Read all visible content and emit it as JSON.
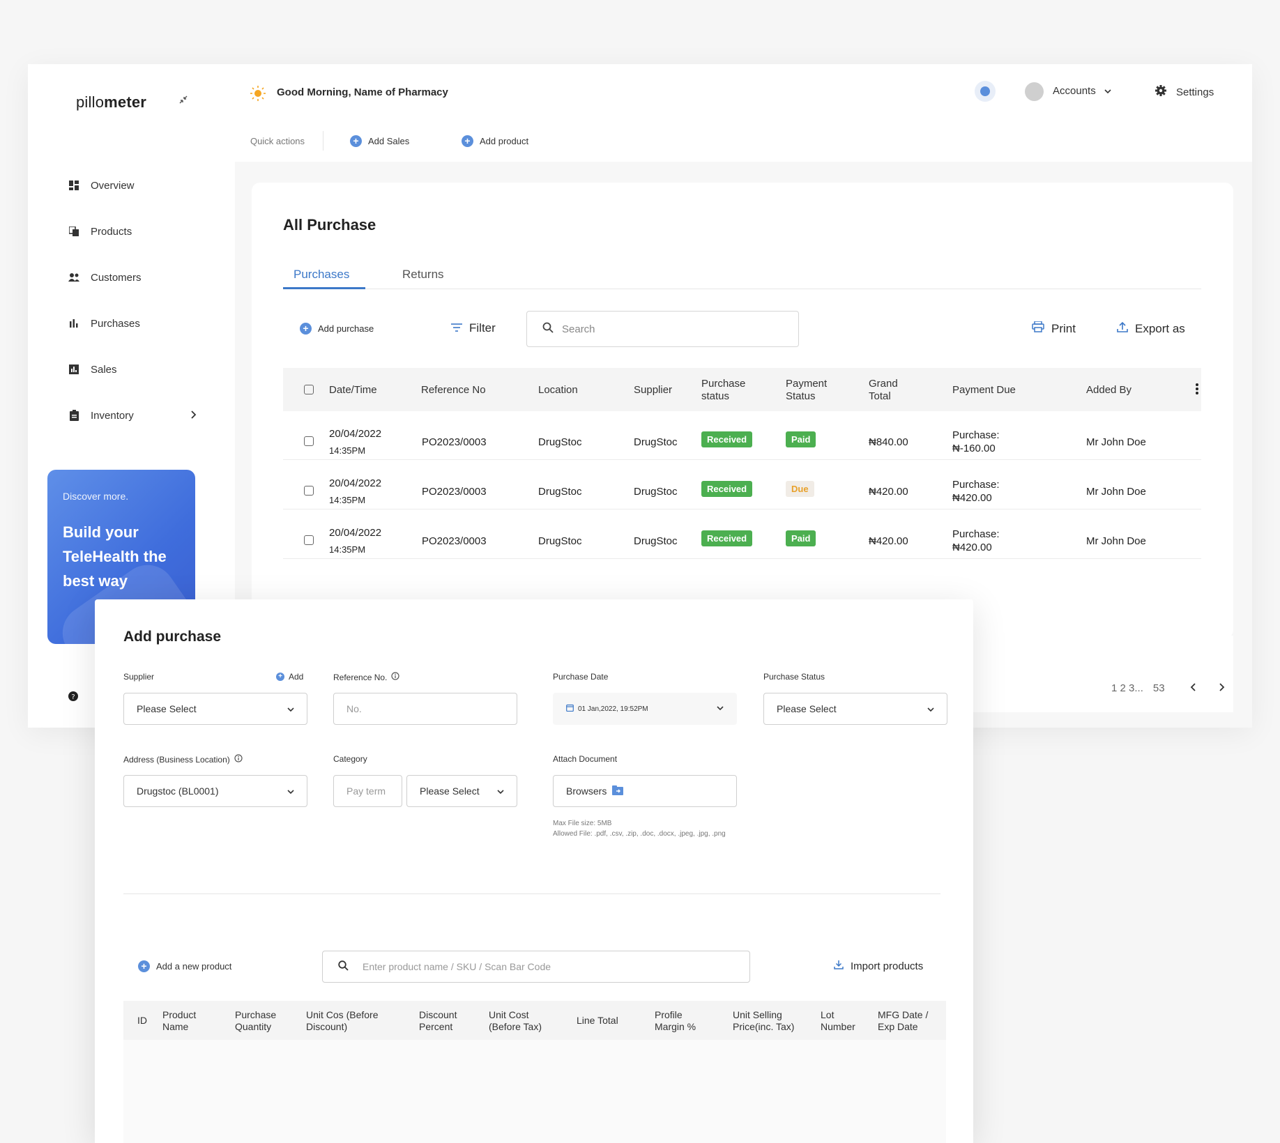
{
  "brand": {
    "prefix": "pillo",
    "suffix": "meter"
  },
  "header": {
    "greeting": "Good Morning, Name of Pharmacy",
    "accounts_label": "Accounts",
    "settings_label": "Settings"
  },
  "quick_actions": {
    "label": "Quick actions",
    "add_sales": "Add Sales",
    "add_product": "Add product"
  },
  "sidebar": {
    "items": [
      {
        "label": "Overview",
        "icon": "grid-icon"
      },
      {
        "label": "Products",
        "icon": "copy-icon"
      },
      {
        "label": "Customers",
        "icon": "users-icon"
      },
      {
        "label": "Purchases",
        "icon": "bar-chart-icon"
      },
      {
        "label": "Sales",
        "icon": "chart-box-icon"
      },
      {
        "label": "Inventory",
        "icon": "clipboard-icon"
      }
    ],
    "promo": {
      "small": "Discover more.",
      "big": "Build your TeleHealth the best way"
    }
  },
  "page": {
    "title": "All Purchase",
    "tabs": [
      "Purchases",
      "Returns"
    ],
    "toolbar": {
      "add_purchase": "Add purchase",
      "filter": "Filter",
      "search_placeholder": "Search",
      "print": "Print",
      "export": "Export as"
    },
    "table": {
      "headers": [
        "Date/Time",
        "Reference No",
        "Location",
        "Supplier",
        "Purchase status",
        "Payment Status",
        "Grand Total",
        "Payment Due",
        "Added By"
      ],
      "rows": [
        {
          "date": "20/04/2022",
          "time": "14:35PM",
          "ref": "PO2023/0003",
          "location": "DrugStoc",
          "supplier": "DrugStoc",
          "pstatus": "Received",
          "paystatus": "Paid",
          "total": "₦840.00",
          "due_label": "Purchase:",
          "due_value": "₦-160.00",
          "added_by": "Mr John Doe"
        },
        {
          "date": "20/04/2022",
          "time": "14:35PM",
          "ref": "PO2023/0003",
          "location": "DrugStoc",
          "supplier": "DrugStoc",
          "pstatus": "Received",
          "paystatus": "Due",
          "total": "₦420.00",
          "due_label": "Purchase:",
          "due_value": "₦420.00",
          "added_by": "Mr John Doe"
        },
        {
          "date": "20/04/2022",
          "time": "14:35PM",
          "ref": "PO2023/0003",
          "location": "DrugStoc",
          "supplier": "DrugStoc",
          "pstatus": "Received",
          "paystatus": "Paid",
          "total": "₦420.00",
          "due_label": "Purchase:",
          "due_value": "₦420.00",
          "added_by": "Mr John Doe"
        }
      ]
    },
    "pagination": {
      "pages": "1 2 3...",
      "last": "53"
    }
  },
  "modal": {
    "title": "Add purchase",
    "supplier": {
      "label": "Supplier",
      "add": "Add",
      "value": "Please Select"
    },
    "reference": {
      "label": "Reference No.",
      "placeholder": "No."
    },
    "purchase_date": {
      "label": "Purchase Date",
      "value": "01 Jan,2022, 19:52PM"
    },
    "purchase_status": {
      "label": "Purchase Status",
      "value": "Please Select"
    },
    "address": {
      "label": "Address (Business Location)",
      "value": "Drugstoc (BL0001)"
    },
    "category": {
      "label": "Category",
      "pay_term": "Pay term",
      "value": "Please Select"
    },
    "attach": {
      "label": "Attach Document",
      "button": "Browsers",
      "max_size": "Max File size: 5MB",
      "allowed": "Allowed File: .pdf, .csv, .zip, .doc, .docx, .jpeg, .jpg, .png"
    },
    "add_new_product": "Add a new product",
    "product_search_placeholder": "Enter product name / SKU / Scan Bar Code",
    "import_products": "Import products",
    "table_headers": [
      "ID",
      "Product Name",
      "Purchase Quantity",
      "Unit Cos (Before Discount)",
      "Discount Percent",
      "Unit Cost (Before Tax)",
      "Line Total",
      "Profile Margin %",
      "Unit Selling Price(inc. Tax)",
      "Lot Number",
      "MFG Date / Exp Date"
    ]
  },
  "colors": {
    "accent": "#3c78c8",
    "green": "#4caf50",
    "due": "#e8a12a",
    "promo": "#4a74de"
  }
}
